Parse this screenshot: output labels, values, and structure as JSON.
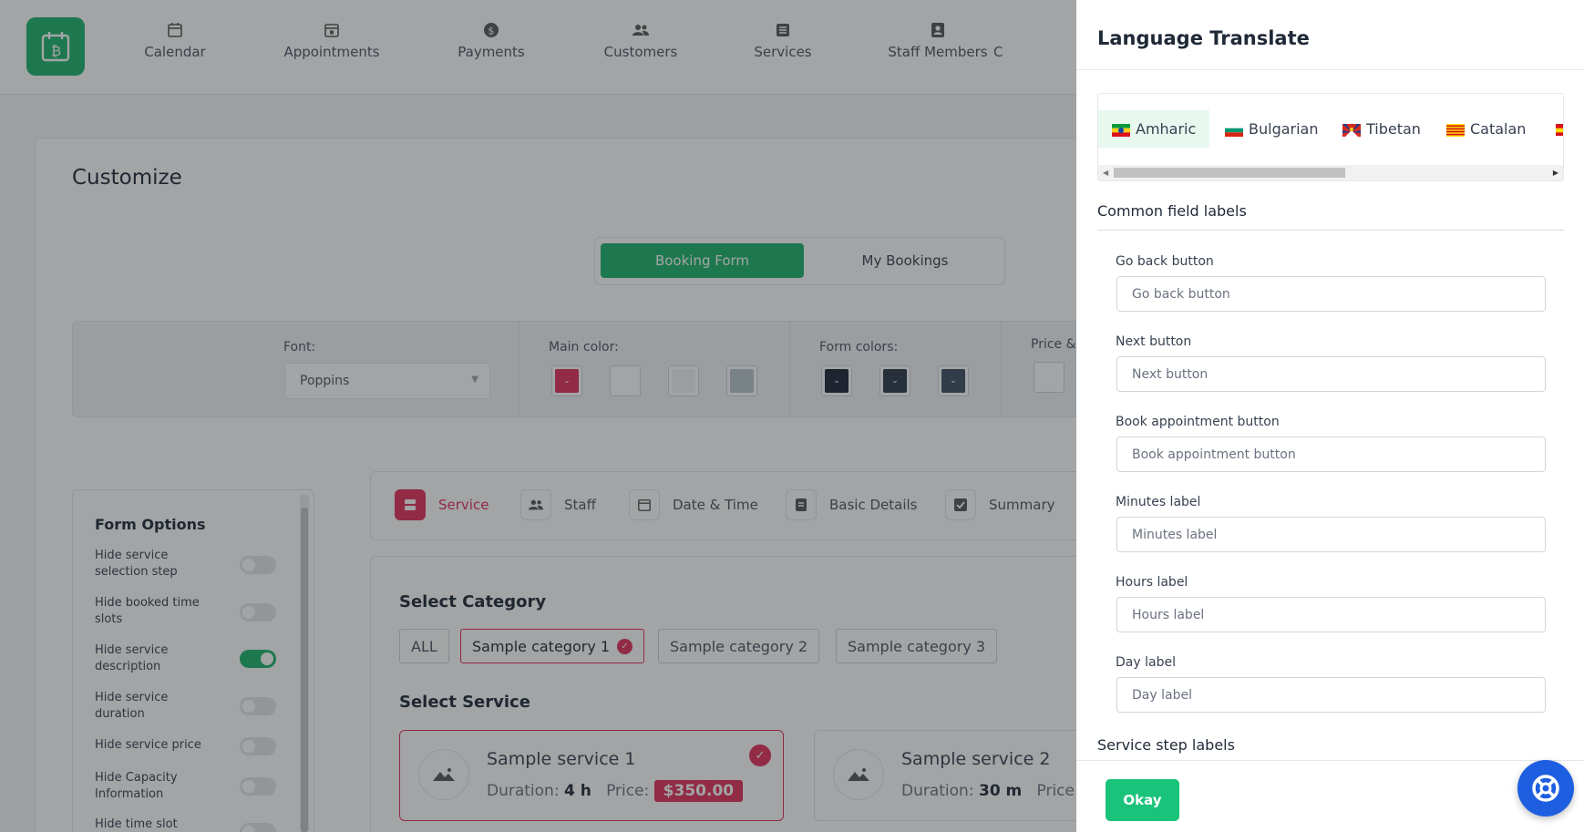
{
  "nav": {
    "items": [
      {
        "label": "Calendar",
        "icon": "calendar-icon"
      },
      {
        "label": "Appointments",
        "icon": "calendar-check-icon"
      },
      {
        "label": "Payments",
        "icon": "dollar-icon"
      },
      {
        "label": "Customers",
        "icon": "users-icon"
      },
      {
        "label": "Services",
        "icon": "list-icon"
      },
      {
        "label": "Staff Members",
        "icon": "id-badge-icon"
      },
      {
        "label": "C",
        "icon": ""
      }
    ]
  },
  "customize": {
    "title": "Customize",
    "tabs": {
      "booking_form": "Booking Form",
      "my_bookings": "My Bookings"
    },
    "font_label": "Font:",
    "font_value": "Poppins",
    "main_color_label": "Main color:",
    "form_colors_label": "Form colors:",
    "price_label": "Price &",
    "colors": {
      "main": [
        "#e2305c",
        "#ffffff",
        "#f3f4f6",
        "#b8c4cc"
      ],
      "form": [
        "#1c2536",
        "#2a3648",
        "#3d4e60"
      ]
    }
  },
  "form_options": {
    "title": "Form Options",
    "items": [
      {
        "label": "Hide service selection step",
        "on": false
      },
      {
        "label": "Hide booked time slots",
        "on": false
      },
      {
        "label": "Hide service description",
        "on": true
      },
      {
        "label": "Hide service duration",
        "on": false
      },
      {
        "label": "Hide service price",
        "on": false
      },
      {
        "label": "Hide Capacity Information",
        "on": false
      },
      {
        "label": "Hide time slot",
        "on": false
      }
    ]
  },
  "steps": [
    {
      "label": "Service",
      "icon": "server-icon",
      "active": true
    },
    {
      "label": "Staff",
      "icon": "users-icon",
      "active": false
    },
    {
      "label": "Date & Time",
      "icon": "calendar-icon",
      "active": false
    },
    {
      "label": "Basic Details",
      "icon": "document-icon",
      "active": false
    },
    {
      "label": "Summary",
      "icon": "check-square-icon",
      "active": false
    }
  ],
  "booking": {
    "category_title": "Select Category",
    "categories": [
      "ALL",
      "Sample category 1",
      "Sample category 2",
      "Sample category 3"
    ],
    "service_title": "Select Service",
    "services": [
      {
        "name": "Sample service 1",
        "duration_label": "Duration:",
        "duration": "4 h",
        "price_label": "Price:",
        "price": "$350.00"
      },
      {
        "name": "Sample service 2",
        "duration_label": "Duration:",
        "duration": "30 m",
        "price_label": "Price:",
        "price": ""
      }
    ]
  },
  "drawer": {
    "title": "Language Translate",
    "languages": [
      "Amharic",
      "Bulgarian",
      "Tibetan",
      "Catalan"
    ],
    "active_language": "Amharic",
    "common_title": "Common field labels",
    "fields": [
      {
        "label": "Go back button",
        "placeholder": "Go back button"
      },
      {
        "label": "Next button",
        "placeholder": "Next button"
      },
      {
        "label": "Book appointment button",
        "placeholder": "Book appointment button"
      },
      {
        "label": "Minutes label",
        "placeholder": "Minutes label"
      },
      {
        "label": "Hours label",
        "placeholder": "Hours label"
      },
      {
        "label": "Day label",
        "placeholder": "Day label"
      }
    ],
    "service_step_title": "Service step labels",
    "okay_label": "Okay"
  }
}
